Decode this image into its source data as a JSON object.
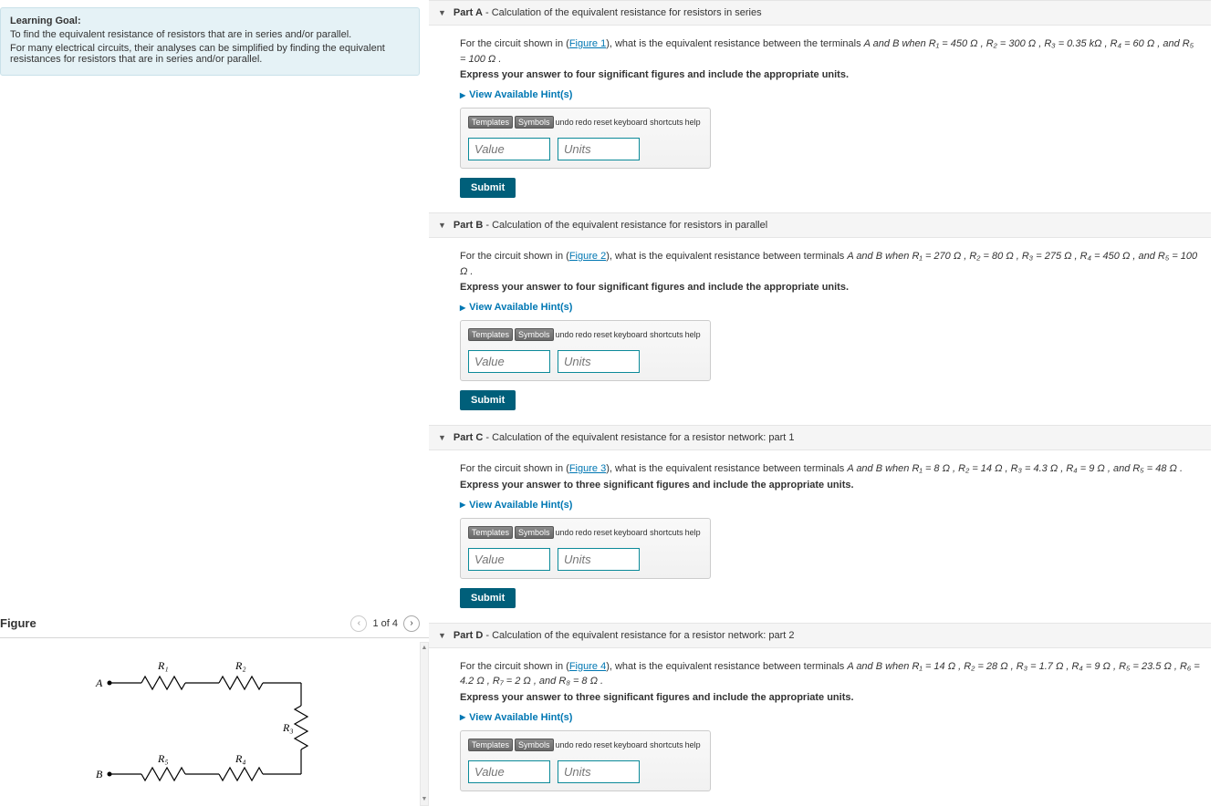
{
  "learning_goal": {
    "title": "Learning Goal:",
    "line1": "To find the equivalent resistance of resistors that are in series and/or parallel.",
    "line2": "For many electrical circuits, their analyses can be simplified by finding the equivalent resistances for resistors that are in series and/or parallel."
  },
  "figure": {
    "title": "Figure",
    "page_indicator": "1 of 4",
    "labels": {
      "R1": "R₁",
      "R2": "R₂",
      "R3": "R₃",
      "R4": "R₄",
      "R5": "R₅",
      "A": "A",
      "B": "B"
    }
  },
  "parts": {
    "A": {
      "label": "Part A",
      "desc": " - Calculation of the equivalent resistance for resistors in series",
      "question_pre": "For the circuit shown in (",
      "figlink": "Figure 1",
      "question_mid": "), what is the equivalent resistance between the terminals ",
      "question_vals": "A and B when R₁ = 450 Ω , R₂ = 300 Ω , R₃ = 0.35 kΩ , R₄ = 60 Ω , and R₅ = 100 Ω .",
      "express": "Express your answer to four significant figures and include the appropriate units."
    },
    "B": {
      "label": "Part B",
      "desc": " - Calculation of the equivalent resistance for resistors in parallel",
      "question_pre": "For the circuit shown in (",
      "figlink": "Figure 2",
      "question_mid": "), what is the equivalent resistance between terminals ",
      "question_vals": "A and B when R₁ = 270 Ω , R₂ = 80 Ω , R₃ = 275 Ω , R₄ = 450 Ω , and R₅ = 100 Ω .",
      "express": "Express your answer to four significant figures and include the appropriate units."
    },
    "C": {
      "label": "Part C",
      "desc": " - Calculation of the equivalent resistance for a resistor network: part 1",
      "question_pre": "For the circuit shown in (",
      "figlink": "Figure 3",
      "question_mid": "), what is the equivalent resistance between terminals ",
      "question_vals": "A and B when R₁ = 8 Ω , R₂ = 14 Ω , R₃ = 4.3 Ω , R₄ = 9 Ω , and R₅ = 48 Ω .",
      "express": "Express your answer to three significant figures and include the appropriate units."
    },
    "D": {
      "label": "Part D",
      "desc": " - Calculation of the equivalent resistance for a resistor network: part 2",
      "question_pre": "For the circuit shown in (",
      "figlink": "Figure 4",
      "question_mid": "), what is the equivalent resistance between terminals ",
      "question_vals": "A and B when R₁ = 14 Ω , R₂ = 28 Ω , R₃ = 1.7 Ω , R₄ = 9 Ω , R₅ = 23.5 Ω , R₆ = 4.2 Ω , R₇ = 2 Ω , and R₈ = 8 Ω .",
      "express": "Express your answer to three significant figures and include the appropriate units."
    }
  },
  "common": {
    "hints": "View Available Hint(s)",
    "templates": "Templates",
    "symbols": "Symbols",
    "undo": "undo",
    "redo": "redo",
    "reset": "reset",
    "keyboard": "keyboard shortcuts",
    "help": "help",
    "value_placeholder": "Value",
    "units_placeholder": "Units",
    "submit": "Submit"
  }
}
